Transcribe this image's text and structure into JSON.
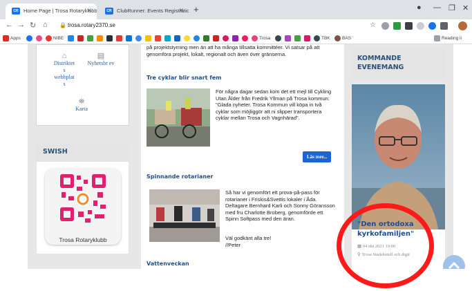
{
  "browser": {
    "tabs": [
      {
        "title": "Home Page | Trosa Rotaryklubb",
        "active": true
      },
      {
        "title": "ClubRunner: Events Registration",
        "active": false
      }
    ],
    "url": "trosa.rotary2370.se",
    "bookmarks": {
      "apps": "Apps",
      "nibe": "NIBE",
      "trosa": "Trosa",
      "tbk": "TBK",
      "bas": "BAS",
      "reading": "Reading li"
    }
  },
  "left": {
    "links": [
      {
        "label": "Distriktet s webbplat s",
        "icon": "building-icon"
      },
      {
        "label": "Nyhetsbr ev",
        "icon": "document-icon"
      },
      {
        "label": "Karta",
        "icon": "map-icon"
      }
    ],
    "swish_title": "SWISH",
    "swish_caption": "Trosa Rotaryklubb"
  },
  "content": {
    "intro_text": "på projektstyrning men än att ha många tillsatta kommittéer. Vi satsar på att genomföra projekt, lokalt, regionalt och även över gränserna.",
    "articles": [
      {
        "title": "Tre cyklar blir snart fem",
        "body": "För några dagar sedan kom det ett mejl till Cykling Utan Ålder från Fredrik Yllman på Trosa kommun: \"Glada nyheter. Trosa Kommun vill köpa in två cyklar som möjliggör att ni slipper transportera cyklar mellan Trosa och Vagnhärad\".",
        "button": "Läs mer..."
      },
      {
        "title": "Spinnande rotarianer",
        "body": "Så har vi genomfört ett prova-på-pass för rotarianer i Friskis&Svettis lokaler i Åda. Deltagare Bernhard Karli och Sonny Göransson med fru Charlotte Broberg, genomförde ett Spinn Softpass med den äran.",
        "sign1": "Väl godkänt alla tre!",
        "sign2": "//Peter"
      }
    ],
    "next_title": "Vattenveckan"
  },
  "right": {
    "heading": "KOMMANDE EVENEMANG",
    "event": {
      "title": "\"Den ortodoxa kyrkofamiljen\"",
      "date": "04 okt 2021 19:00",
      "location": "Trosa Stadshotell och digit"
    }
  },
  "colors": {
    "accent_blue": "#1f4e8c",
    "button_blue": "#1a64d6",
    "annotation_red": "#ff1a1a"
  }
}
